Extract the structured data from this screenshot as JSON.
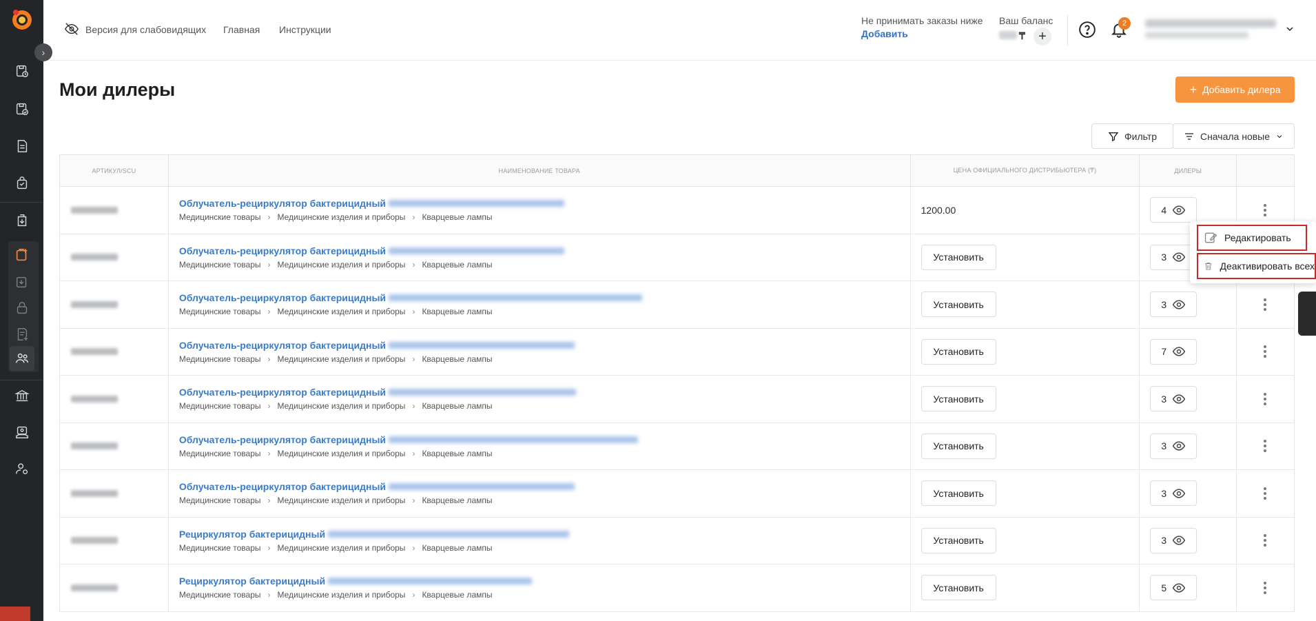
{
  "header": {
    "accessibility": "Версия для слабовидящих",
    "nav": [
      "Главная",
      "Инструкции"
    ],
    "min_order_label": "Не принимать заказы ниже",
    "min_order_add": "Добавить",
    "balance_label": "Ваш баланс",
    "balance_currency": "₸",
    "notifications_count": "2"
  },
  "page": {
    "title": "Мои дилеры",
    "add_dealer": "Добавить дилера",
    "filter": "Фильтр",
    "sort": "Сначала новые"
  },
  "table": {
    "columns": [
      "Артикул/SCU",
      "Наименование товара",
      "Цена официального дистрибьютера (₸)",
      "Дилеры",
      ""
    ],
    "rows": [
      {
        "name": "Облучатель-рециркулятор бактерицидный",
        "price": "1200.00",
        "dealers": "4"
      },
      {
        "name": "Облучатель-рециркулятор бактерицидный",
        "price": "",
        "dealers": "3"
      },
      {
        "name": "Облучатель-рециркулятор бактерицидный",
        "price": "",
        "dealers": "3"
      },
      {
        "name": "Облучатель-рециркулятор бактерицидный",
        "price": "",
        "dealers": "7"
      },
      {
        "name": "Облучатель-рециркулятор бактерицидный",
        "price": "",
        "dealers": "3"
      },
      {
        "name": "Облучатель-рециркулятор бактерицидный",
        "price": "",
        "dealers": "3"
      },
      {
        "name": "Облучатель-рециркулятор бактерицидный",
        "price": "",
        "dealers": "3"
      },
      {
        "name": "Рециркулятор бактерицидный",
        "price": "",
        "dealers": "3"
      },
      {
        "name": "Рециркулятор бактерицидный",
        "price": "",
        "dealers": "5"
      }
    ],
    "breadcrumbs": [
      "Медицинские товары",
      "Медицинские изделия и приборы",
      "Кварцевые лампы"
    ],
    "set_price_label": "Установить"
  },
  "context_menu": {
    "edit": "Редактировать",
    "deactivate": "Деактивировать всех"
  },
  "colors": {
    "accent": "#f7953f",
    "link": "#3a7bc8",
    "sidebar": "#232527",
    "highlight": "#c62828"
  }
}
